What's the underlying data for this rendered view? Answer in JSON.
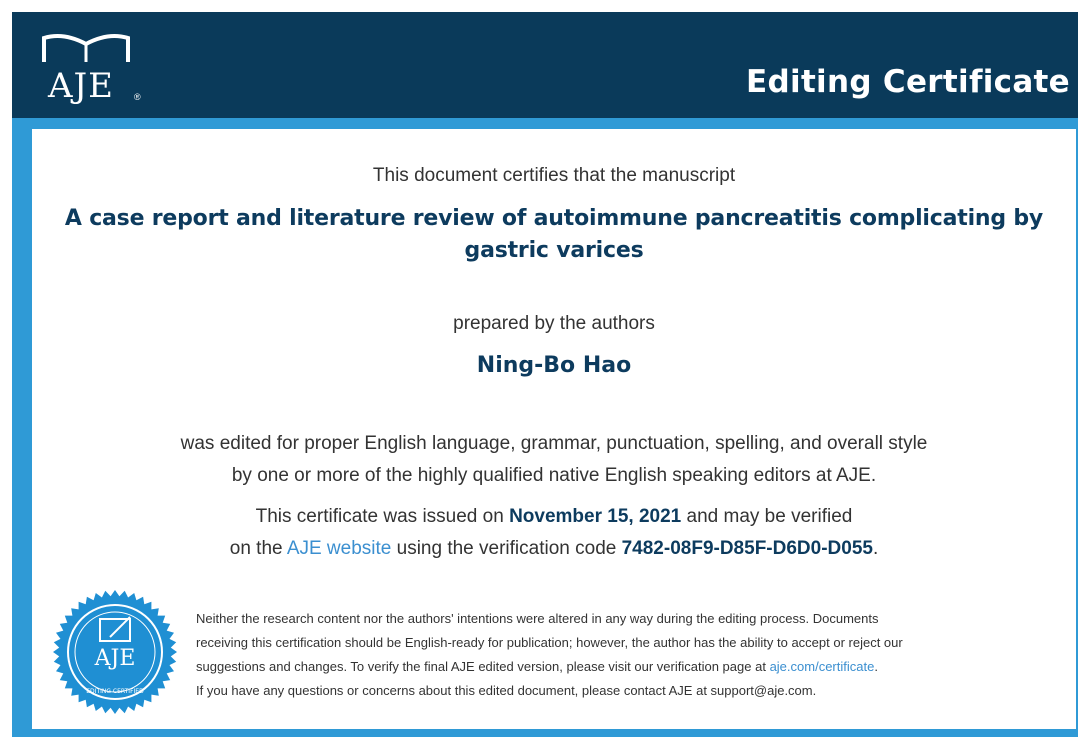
{
  "header": {
    "logo_text": "AJE",
    "logo_reg": "®",
    "title": "Editing Certificate"
  },
  "certificate": {
    "intro": "This document certifies that the manuscript",
    "manuscript_title_line1": "A case report and literature review of autoimmune pancreatitis complicating by",
    "manuscript_title_line2": "gastric varices",
    "prepared_by": "prepared by the authors",
    "author": "Ning-Bo Hao",
    "edited_line1": "was edited for proper English language, grammar, punctuation, spelling, and overall style",
    "edited_line2": "by one or more of the highly qualified native English speaking editors at AJE.",
    "issued_prefix": "This certificate was issued on",
    "issued_date": "November 15, 2021",
    "issued_suffix": "and may be verified",
    "verify_prefix": "on the",
    "verify_link": "AJE website",
    "verify_middle": "using the verification code",
    "verification_code": "7482-08F9-D85F-D6D0-D055",
    "verify_suffix": "."
  },
  "seal": {
    "text": "AJE",
    "ring_text": "EDITING CERTIFIED",
    "color": "#1f8fd3"
  },
  "disclaimer": {
    "line1": "Neither the research content nor the authors' intentions were altered in any way during the editing process. Documents",
    "line2": "receiving this certification should be English-ready for publication; however, the author has the ability to accept or reject our",
    "line3_prefix": "suggestions and changes. To verify the final AJE edited version, please visit our verification page at",
    "line3_link": "aje.com/certificate",
    "line3_suffix": ".",
    "line4": "If you have any questions or concerns about this edited document, please contact AJE at support@aje.com."
  },
  "colors": {
    "header_bg": "#0a3a5a",
    "border": "#2f9ad6",
    "accent_text": "#0d3b5e",
    "link": "#3b8fd0"
  }
}
